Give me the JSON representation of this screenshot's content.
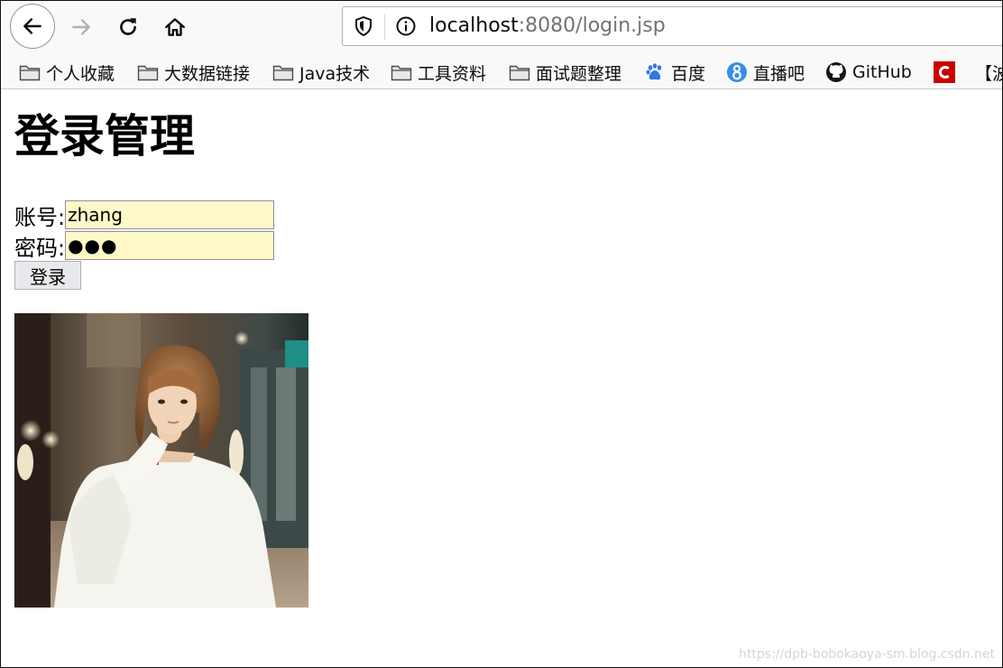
{
  "browser": {
    "url_host": "localhost",
    "url_rest": ":8080/login.jsp",
    "icons": {
      "back": "arrow-left-icon",
      "forward": "arrow-right-icon",
      "reload": "reload-icon",
      "home": "home-icon",
      "tracking": "shield-icon",
      "site_info": "info-icon"
    }
  },
  "bookmarks": [
    {
      "label": "个人收藏",
      "icon": "folder-icon"
    },
    {
      "label": "大数据链接",
      "icon": "folder-icon"
    },
    {
      "label": "Java技术",
      "icon": "folder-icon"
    },
    {
      "label": "工具资料",
      "icon": "folder-icon"
    },
    {
      "label": "面试题整理",
      "icon": "folder-icon"
    },
    {
      "label": "百度",
      "icon": "baidu-paw-icon"
    },
    {
      "label": "直播吧",
      "icon": "zhibo8-icon"
    },
    {
      "label": "GitHub",
      "icon": "github-icon"
    },
    {
      "label": "",
      "icon": "csdn-icon"
    },
    {
      "label": "【波",
      "icon": ""
    }
  ],
  "page": {
    "title": "登录管理",
    "account_label": "账号:",
    "account_value": "zhang",
    "password_label": "密码:",
    "password_value": "●●●",
    "login_button": "登录",
    "watermark": "https://dpb-bobokaoya-sm.blog.csdn.net"
  },
  "colors": {
    "autofill_bg": "#fff8c8",
    "button_bg": "#e9e9ed",
    "chrome_bg": "#f9f9fa",
    "csdn_red": "#c90000",
    "baidu_blue": "#2f78e8",
    "zhibo8_blue": "#3a8ee6"
  }
}
